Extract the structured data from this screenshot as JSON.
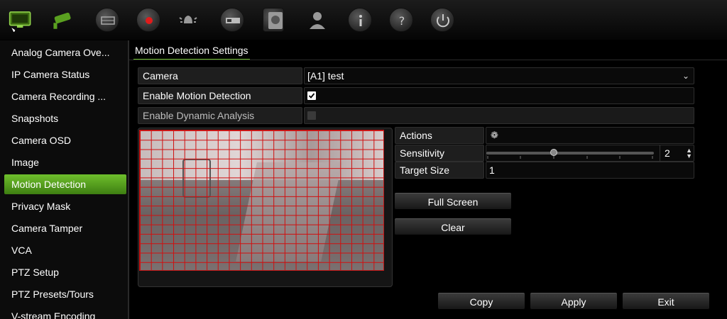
{
  "toolbar": {
    "icons": [
      "monitor-icon",
      "camera-icon",
      "network-icon",
      "record-icon",
      "alarm-icon",
      "device-icon",
      "storage-icon",
      "user-icon",
      "info-icon",
      "help-icon",
      "power-icon"
    ],
    "accent": "#6bbb2a"
  },
  "sidebar": {
    "items": [
      {
        "label": "Analog Camera Ove..."
      },
      {
        "label": "IP Camera Status"
      },
      {
        "label": "Camera Recording ..."
      },
      {
        "label": "Snapshots"
      },
      {
        "label": "Camera OSD"
      },
      {
        "label": "Image"
      },
      {
        "label": "Motion Detection"
      },
      {
        "label": "Privacy Mask"
      },
      {
        "label": "Camera Tamper"
      },
      {
        "label": "VCA"
      },
      {
        "label": "PTZ Setup"
      },
      {
        "label": "PTZ Presets/Tours"
      },
      {
        "label": "V-stream Encoding"
      }
    ],
    "active_index": 6
  },
  "main": {
    "tab_title": "Motion Detection Settings",
    "camera": {
      "label": "Camera",
      "value": "[A1] test"
    },
    "enable_motion": {
      "label": "Enable Motion Detection",
      "checked": true
    },
    "enable_dynamic": {
      "label": "Enable Dynamic Analysis",
      "checked": false
    },
    "actions": {
      "label": "Actions"
    },
    "sensitivity": {
      "label": "Sensitivity",
      "value": "2",
      "level": 0.4
    },
    "target_size": {
      "label": "Target Size",
      "value": "1"
    },
    "buttons": {
      "full_screen": "Full Screen",
      "clear": "Clear",
      "copy": "Copy",
      "apply": "Apply",
      "exit": "Exit"
    },
    "grid_color": "#d01010"
  }
}
